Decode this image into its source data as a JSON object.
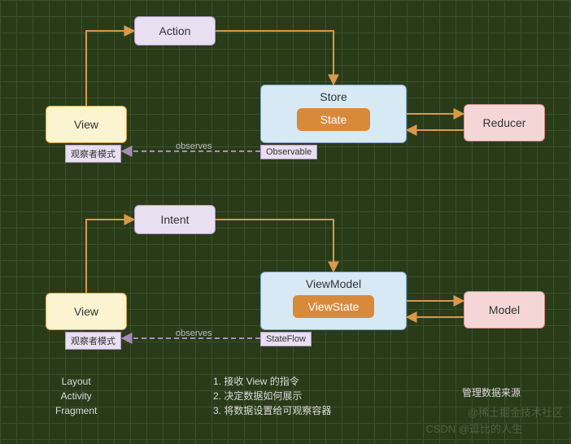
{
  "top": {
    "view": "View",
    "action": "Action",
    "store": "Store",
    "state": "State",
    "reducer": "Reducer",
    "observer_tag": "观察者模式",
    "observable_tag": "Observable",
    "observes": "observes"
  },
  "bottom": {
    "view": "View",
    "intent": "Intent",
    "viewmodel": "ViewModel",
    "viewstate": "ViewState",
    "model": "Model",
    "observer_tag": "观察者模式",
    "stateflow_tag": "StateFlow",
    "observes": "observes"
  },
  "captions": {
    "left": "Layout\nActivity\nFragment",
    "center": "1. 接收 View 的指令\n2. 决定数据如何展示\n3. 将数据设置给可观察容器",
    "right": "管理数据来源"
  },
  "watermarks": {
    "w1": "@稀土掘金技术社区",
    "w2": "CSDN @逗比的人生"
  }
}
